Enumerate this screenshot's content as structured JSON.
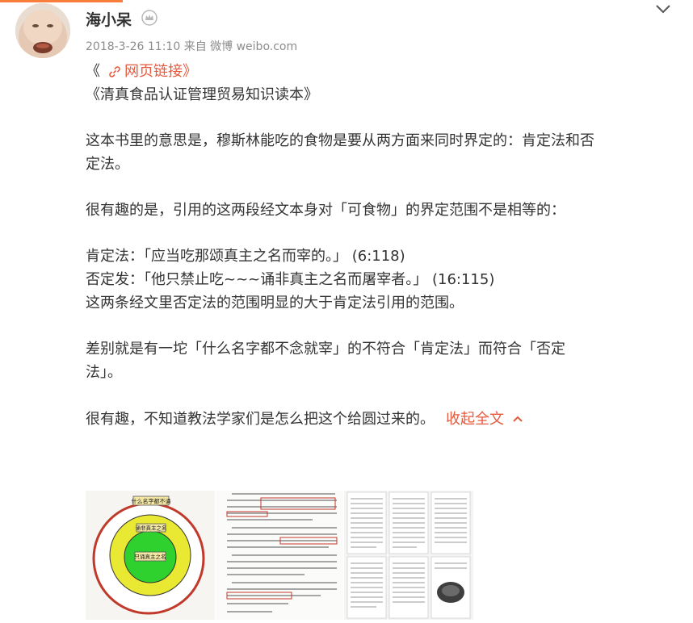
{
  "user": {
    "name": "海小呆",
    "meta": "2018-3-26 11:10 来自 微博 weibo.com"
  },
  "post": {
    "link_prefix": "《",
    "link_text": "网页链接》",
    "lines": [
      "《清真食品认证管理贸易知识读本》",
      "",
      "这本书里的意思是，穆斯林能吃的食物是要从两方面来同时界定的：肯定法和否",
      "定法。",
      "",
      "很有趣的是，引用的这两段经文本身对「可食物」的界定范围不是相等的：",
      "",
      "肯定法：「应当吃那颂真主之名而宰的。」  (6:118)",
      "否定发：「他只禁止吃~~~诵非真主之名而屠宰者。」  (16:115)",
      "这两条经文里否定法的范围明显的大于肯定法引用的范围。",
      "",
      "差别就是有一坨「什么名字都不念就宰」的不符合「肯定法」而符合「否定",
      "法」。",
      ""
    ],
    "last_line": "很有趣，不知道教法学家们是怎么把这个给圆过来的。",
    "collapse_label": "收起全文"
  },
  "images": {
    "diagram_outer": "什么名字都不诵",
    "diagram_middle": "诵非真主之名",
    "diagram_inner": "只诵真主之名"
  },
  "colors": {
    "accent": "#e55a3e",
    "top_bar": "#fa7d3c"
  }
}
